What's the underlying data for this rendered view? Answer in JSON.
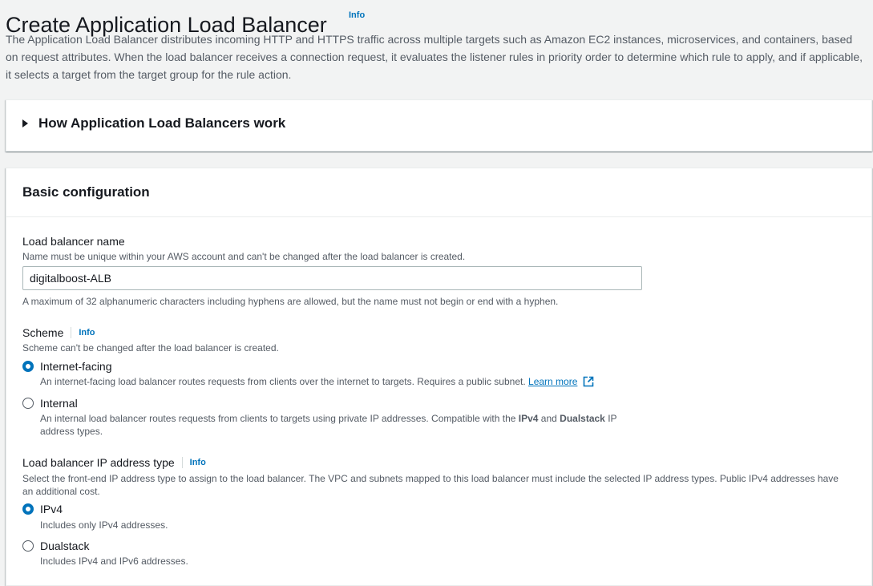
{
  "header": {
    "title": "Create Application Load Balancer",
    "info": "Info",
    "description": "The Application Load Balancer distributes incoming HTTP and HTTPS traffic across multiple targets such as Amazon EC2 instances, microservices, and containers, based on request attributes. When the load balancer receives a connection request, it evaluates the listener rules in priority order to determine which rule to apply, and if applicable, it selects a target from the target group for the rule action."
  },
  "how_it_works": {
    "label": "How Application Load Balancers work",
    "expanded": false
  },
  "basic_config": {
    "title": "Basic configuration",
    "name_field": {
      "label": "Load balancer name",
      "description": "Name must be unique within your AWS account and can't be changed after the load balancer is created.",
      "value": "digitalboost-ALB",
      "constraint": "A maximum of 32 alphanumeric characters including hyphens are allowed, but the name must not begin or end with a hyphen."
    },
    "scheme": {
      "label": "Scheme",
      "info": "Info",
      "description": "Scheme can't be changed after the load balancer is created.",
      "options": [
        {
          "label": "Internet-facing",
          "checked": true,
          "description": "An internet-facing load balancer routes requests from clients over the internet to targets. Requires a public subnet.",
          "link": "Learn more"
        },
        {
          "label": "Internal",
          "checked": false,
          "desc_part1": "An internal load balancer routes requests from clients to targets using private IP addresses. Compatible with the ",
          "desc_b1": "IPv4",
          "desc_part2": " and ",
          "desc_b2": "Dualstack",
          "desc_part3": " IP",
          "desc_line2": "address types."
        }
      ]
    },
    "ip_type": {
      "label": "Load balancer IP address type",
      "info": "Info",
      "description_line1": "Select the front-end IP address type to assign to the load balancer. The VPC and subnets mapped to this load balancer must include the selected IP address types. Public IPv4 addresses have",
      "description_line2": "an additional cost.",
      "options": [
        {
          "label": "IPv4",
          "checked": true,
          "description": "Includes only IPv4 addresses."
        },
        {
          "label": "Dualstack",
          "checked": false,
          "description": "Includes IPv4 and IPv6 addresses."
        }
      ]
    }
  },
  "colors": {
    "link": "#0073bb",
    "text": "#16191f",
    "muted": "#545b64",
    "page_bg": "#f2f3f3"
  },
  "icons": {
    "expander": "caret-right-icon",
    "external": "external-link-icon"
  }
}
